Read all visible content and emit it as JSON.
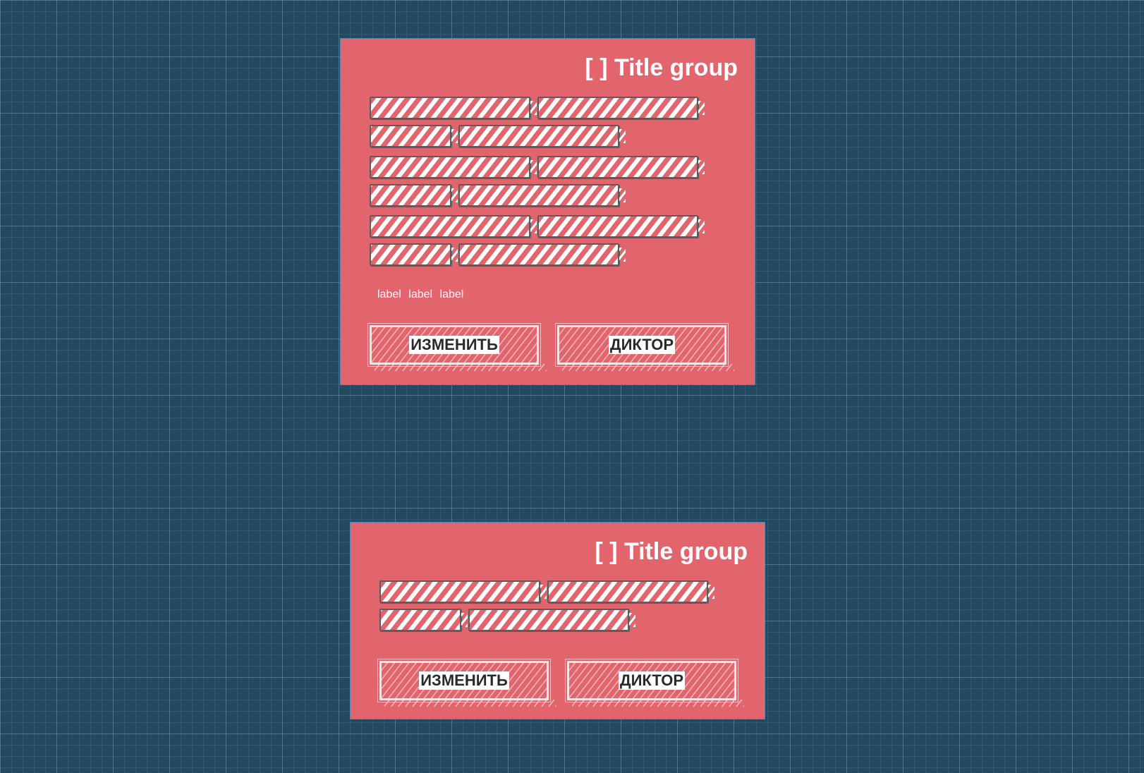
{
  "cards": [
    {
      "title": "[ ] Title group",
      "labels": [
        "label",
        "label",
        "label"
      ],
      "buttons": {
        "edit": "ИЗМЕНИТЬ",
        "narrator": "ДИКТОР"
      }
    },
    {
      "title": "[ ] Title group",
      "buttons": {
        "edit": "ИЗМЕНИТЬ",
        "narrator": "ДИКТОР"
      }
    }
  ],
  "colors": {
    "background": "#244a61",
    "card": "#e2646d",
    "placeholder_border": "#5d5d5d",
    "text": "#ffffff"
  },
  "icons": [
    "placeholder-text-bar"
  ]
}
